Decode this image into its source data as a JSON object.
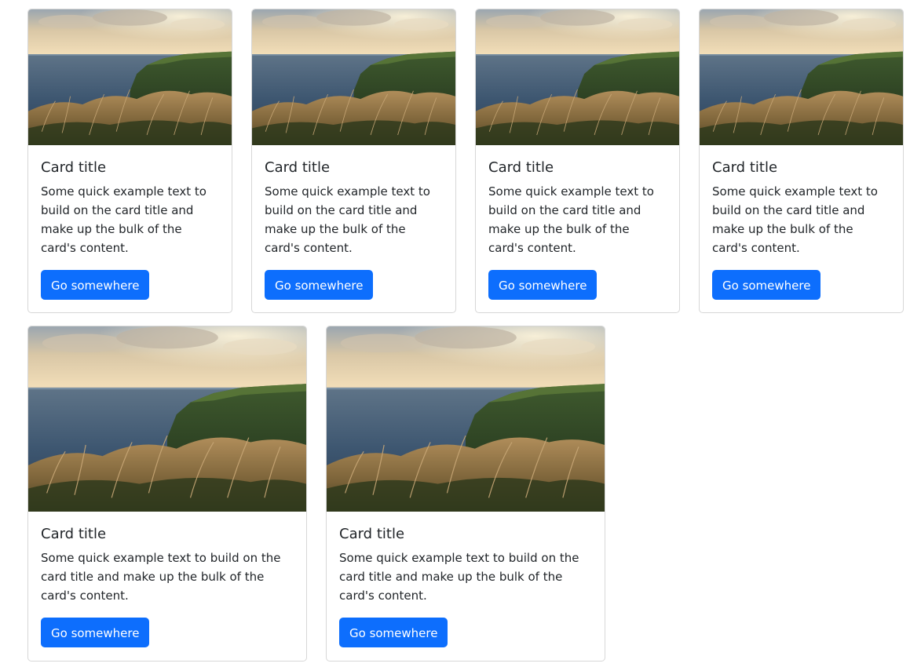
{
  "cards": [
    {
      "title": "Card title",
      "text": "Some quick example text to build on the card title and make up the bulk of the card's content.",
      "button": "Go somewhere",
      "image": "coastal-cliff-sunset-photo"
    },
    {
      "title": "Card title",
      "text": "Some quick example text to build on the card title and make up the bulk of the card's content.",
      "button": "Go somewhere",
      "image": "coastal-cliff-sunset-photo"
    },
    {
      "title": "Card title",
      "text": "Some quick example text to build on the card title and make up the bulk of the card's content.",
      "button": "Go somewhere",
      "image": "coastal-cliff-sunset-photo"
    },
    {
      "title": "Card title",
      "text": "Some quick example text to build on the card title and make up the bulk of the card's content.",
      "button": "Go somewhere",
      "image": "coastal-cliff-sunset-photo"
    },
    {
      "title": "Card title",
      "text": "Some quick example text to build on the card title and make up the bulk of the card's content.",
      "button": "Go somewhere",
      "image": "coastal-cliff-sunset-photo"
    },
    {
      "title": "Card title",
      "text": "Some quick example text to build on the card title and make up the bulk of the card's content.",
      "button": "Go somewhere",
      "image": "coastal-cliff-sunset-photo"
    }
  ],
  "colors": {
    "button_bg": "#0d6efd",
    "button_text": "#ffffff",
    "card_border": "#d7d7d7",
    "text": "#212529"
  }
}
